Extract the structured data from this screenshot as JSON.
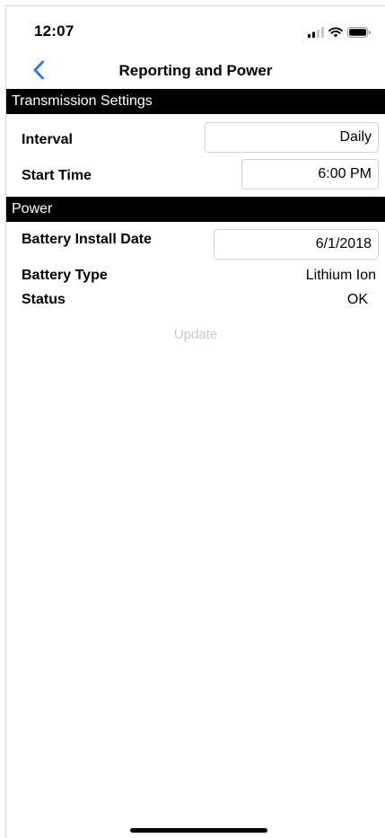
{
  "status_bar": {
    "time": "12:07",
    "icons": [
      "signal-icon",
      "wifi-icon",
      "battery-icon"
    ]
  },
  "nav": {
    "back_icon": "chevron-left-icon",
    "title": "Reporting and Power"
  },
  "transmission": {
    "header": "Transmission Settings",
    "interval_label": "Interval",
    "interval_value": "Daily",
    "start_time_label": "Start Time",
    "start_time_value": "6:00 PM"
  },
  "power": {
    "header": "Power",
    "install_date_label": "Battery Install Date",
    "install_date_value": "6/1/2018",
    "battery_type_label": "Battery Type",
    "battery_type_value": "Lithium Ion",
    "status_label": "Status",
    "status_value": "OK"
  },
  "actions": {
    "update_label": "Update"
  },
  "colors": {
    "accent": "#3478f6",
    "header_bg": "#000000",
    "disabled_text": "#c9c9c9",
    "field_border": "#d2d2d2"
  }
}
